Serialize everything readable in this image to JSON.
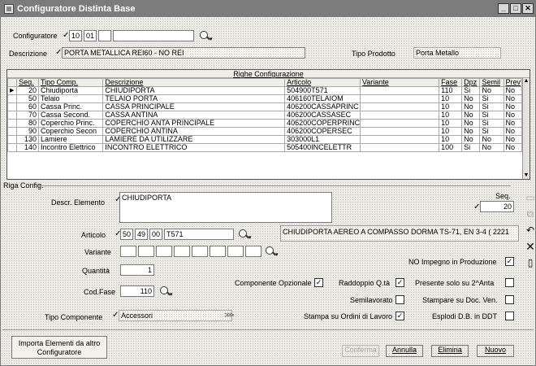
{
  "window": {
    "title": "Configuratore Distinta Base",
    "controls": [
      "_",
      "□",
      "✕"
    ]
  },
  "header": {
    "configuratore_label": "Configuratore",
    "configuratore_codes": [
      "10",
      "01",
      "",
      ""
    ],
    "descrizione_label": "Descrizione",
    "descrizione_value": "PORTA METALLICA REI60 - NO REI",
    "tipo_prodotto_label": "Tipo Prodotto",
    "tipo_prodotto_value": "Porta Metallo"
  },
  "grid": {
    "title": "Righe Configurazione",
    "columns": [
      "Seq.",
      "Tipo Comp.",
      "Descrizione",
      "Articolo",
      "Variante",
      "Fase",
      "Dpz",
      "Semil",
      "Prev"
    ],
    "rows": [
      {
        "seq": "20",
        "tipo": "Chiudiporta",
        "descrizione": "CHIUDIPORTA",
        "articolo": "504900T571",
        "variante": "",
        "fase": "110",
        "dpz": "Si",
        "semil": "No",
        "prev": "No"
      },
      {
        "seq": "50",
        "tipo": "Telaio",
        "descrizione": "TELAIO PORTA",
        "articolo": "406160TELAIOM",
        "variante": "",
        "fase": "10",
        "dpz": "No",
        "semil": "Si",
        "prev": "No"
      },
      {
        "seq": "60",
        "tipo": "Cassa Princ.",
        "descrizione": "CASSA PRINCIPALE",
        "articolo": "406200CASSAPRINC",
        "variante": "",
        "fase": "10",
        "dpz": "No",
        "semil": "Si",
        "prev": "No"
      },
      {
        "seq": "70",
        "tipo": "Cassa Second.",
        "descrizione": "CASSA ANTINA",
        "articolo": "406200CASSASEC",
        "variante": "",
        "fase": "10",
        "dpz": "No",
        "semil": "Si",
        "prev": "No"
      },
      {
        "seq": "80",
        "tipo": "Coperchio Princ.",
        "descrizione": "COPERCHIO ANTA PRINCIPALE",
        "articolo": "406200COPERPRINC",
        "variante": "",
        "fase": "10",
        "dpz": "No",
        "semil": "Si",
        "prev": "No"
      },
      {
        "seq": "90",
        "tipo": "Coperchio Secon",
        "descrizione": "COPERCHIO ANTINA",
        "articolo": "406200COPERSEC",
        "variante": "",
        "fase": "10",
        "dpz": "No",
        "semil": "Si",
        "prev": "No"
      },
      {
        "seq": "130",
        "tipo": "Lamiere",
        "descrizione": "LAMIERE DA UTILIZZARE",
        "articolo": "303000L1",
        "variante": "",
        "fase": "10",
        "dpz": "No",
        "semil": "No",
        "prev": "No"
      },
      {
        "seq": "140",
        "tipo": "Incontro Elettrico",
        "descrizione": "INCONTRO ELETTRICO",
        "articolo": "505400INCELETTR",
        "variante": "",
        "fase": "100",
        "dpz": "Si",
        "semil": "No",
        "prev": "No"
      }
    ]
  },
  "detail": {
    "section_label": "Riga Config.",
    "descr_elemento_label": "Descr. Elemento",
    "descr_elemento_value": "CHIUDIPORTA",
    "seq_label": "Seq.",
    "seq_value": "20",
    "articolo_label": "Articolo",
    "articolo_codes": [
      "50",
      "49",
      "00",
      "T571"
    ],
    "articolo_desc": "CHIUDIPORTA AEREO A COMPASSO DORMA TS-71, EN 3-4 ( 2221",
    "variante_label": "Variante",
    "quantita_label": "Quantità",
    "quantita_value": "1",
    "cod_fase_label": "Cod.Fase",
    "cod_fase_value": "110",
    "tipo_componente_label": "Tipo Componente",
    "tipo_componente_value": "Accessori",
    "no_impegno_label": "NO Impegno in Produzione",
    "no_impegno_checked": true,
    "componente_opzionale_label": "Componente Opzionale",
    "componente_opzionale_checked": true,
    "raddoppio_label": "Raddoppio Q.tà",
    "raddoppio_checked": true,
    "presente_label": "Presente solo su 2^Anta",
    "presente_checked": false,
    "semilavorato_label": "Semilavorato",
    "semilavorato_checked": false,
    "stampare_doc_label": "Stampare su Doc. Ven.",
    "stampare_doc_checked": false,
    "stampa_ordini_label": "Stampa su Ordini di Lavoro",
    "stampa_ordini_checked": true,
    "esplodi_label": "Esplodi D.B. in DDT",
    "esplodi_checked": false
  },
  "buttons": {
    "importa": "Importa Elementi da altro Configuratore",
    "conferma": "Conferma",
    "annulla": "Annulla",
    "elimina": "Elimina",
    "nuovo": "Nuovo"
  }
}
